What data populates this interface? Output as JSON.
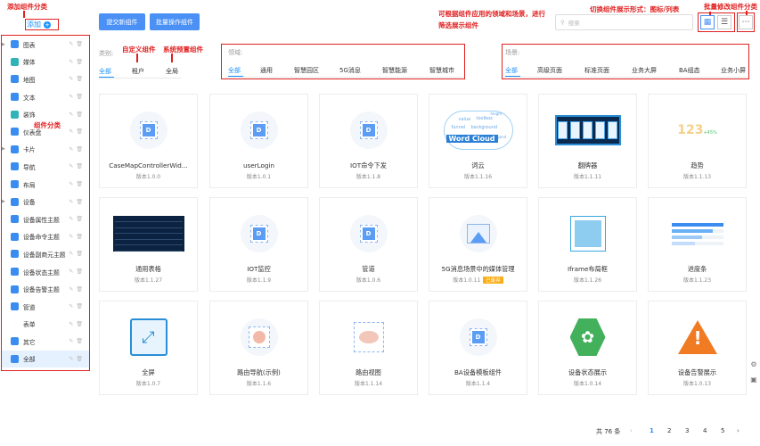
{
  "annotations": {
    "add_category": "添加组件分类",
    "custom_component": "自定义组件",
    "system_component": "系统预置组件",
    "domain_scene": "可根据组件应用的领域和场景，进行筛选展示组件",
    "view_switch": "切换组件展示形式：图标/列表",
    "batch_edit": "批量修改组件分类",
    "category": "组件分类"
  },
  "sidebar": {
    "add_label": "添加",
    "items": [
      {
        "label": "图表",
        "color": "#3b8cf0",
        "caret": true
      },
      {
        "label": "媒体",
        "color": "#2fb3b8",
        "caret": false
      },
      {
        "label": "地图",
        "color": "#3b8cf0",
        "caret": false
      },
      {
        "label": "文本",
        "color": "#3b8cf0",
        "caret": false
      },
      {
        "label": "装饰",
        "color": "#2fb3b8",
        "caret": false
      },
      {
        "label": "仪表盘",
        "color": "#3b8cf0",
        "caret": false
      },
      {
        "label": "卡片",
        "color": "#3b8cf0",
        "caret": true
      },
      {
        "label": "导航",
        "color": "#3b8cf0",
        "caret": false
      },
      {
        "label": "布局",
        "color": "#3b8cf0",
        "caret": false
      },
      {
        "label": "设备",
        "color": "#3b8cf0",
        "caret": true
      },
      {
        "label": "设备属性主题",
        "color": "#3b8cf0",
        "caret": false
      },
      {
        "label": "设备命令主题",
        "color": "#3b8cf0",
        "caret": false
      },
      {
        "label": "设备副商元主题",
        "color": "#3b8cf0",
        "caret": false
      },
      {
        "label": "设备状态主题",
        "color": "#3b8cf0",
        "caret": false
      },
      {
        "label": "设备告警主题",
        "color": "#3b8cf0",
        "caret": false
      },
      {
        "label": "管道",
        "color": "#3b8cf0",
        "caret": false
      },
      {
        "label": "表单",
        "color": "",
        "caret": false
      },
      {
        "label": "其它",
        "color": "#3b8cf0",
        "caret": false
      },
      {
        "label": "全部",
        "color": "#3b8cf0",
        "caret": false,
        "active": true
      }
    ]
  },
  "toolbar": {
    "submit_label": "提交新组件",
    "batch_label": "批量操作组件",
    "search_placeholder": "搜索"
  },
  "filters": {
    "type_label": "类别:",
    "type_tabs": [
      "全部",
      "租户",
      "全局"
    ],
    "domain_label": "领域:",
    "domain_tabs": [
      "全部",
      "通用",
      "智慧园区",
      "5G消息",
      "智慧能源",
      "智慧城市"
    ],
    "scene_label": "场景:",
    "scene_tabs": [
      "全部",
      "高级页面",
      "标准页面",
      "业务大屏",
      "BA组态",
      "业务小屏"
    ]
  },
  "cards": [
    {
      "name": "CaseMapControllerWid...",
      "version": "版本1.0.0",
      "thumb": "d"
    },
    {
      "name": "userLogin",
      "version": "版本1.0.1",
      "thumb": "d"
    },
    {
      "name": "IOT命令下发",
      "version": "版本1.1.8",
      "thumb": "d"
    },
    {
      "name": "词云",
      "version": "版本1.1.16",
      "thumb": "wordcloud"
    },
    {
      "name": "翻牌器",
      "version": "版本1.1.11",
      "thumb": "flip"
    },
    {
      "name": "趋势",
      "version": "版本1.1.13",
      "thumb": "trend"
    },
    {
      "name": "通用表格",
      "version": "版本1.1.27",
      "thumb": "table"
    },
    {
      "name": "IOT监控",
      "version": "版本1.1.9",
      "thumb": "d"
    },
    {
      "name": "管道",
      "version": "版本1.0.6",
      "thumb": "d"
    },
    {
      "name": "5G消息场景中的媒体管理",
      "version": "版本1.0.11",
      "badge": "已废弃",
      "thumb": "media"
    },
    {
      "name": "Iframe布局框",
      "version": "版本1.1.26",
      "thumb": "iframe"
    },
    {
      "name": "进度条",
      "version": "版本1.1.23",
      "thumb": "progress"
    },
    {
      "name": "全屏",
      "version": "版本1.0.7",
      "thumb": "fullscreen"
    },
    {
      "name": "路由导航(示例)",
      "version": "版本1.1.6",
      "thumb": "route"
    },
    {
      "name": "路由视图",
      "version": "版本1.1.14",
      "thumb": "routeview"
    },
    {
      "name": "BA设备模板组件",
      "version": "版本1.1.4",
      "thumb": "d"
    },
    {
      "name": "设备状态展示",
      "version": "版本1.0.14",
      "thumb": "fan"
    },
    {
      "name": "设备告警展示",
      "version": "版本1.0.13",
      "thumb": "alarm"
    }
  ],
  "thumb_texts": {
    "d": "D",
    "word_cloud": "Word Cloud",
    "wc_words": [
      "value",
      "toolbox",
      "funnel",
      "background",
      "height",
      "legend"
    ],
    "trend_value": "123",
    "trend_pct": "+45%"
  },
  "pager": {
    "total": "共 76 条",
    "pages": [
      "1",
      "2",
      "3",
      "4",
      "5"
    ],
    "current": "1"
  }
}
